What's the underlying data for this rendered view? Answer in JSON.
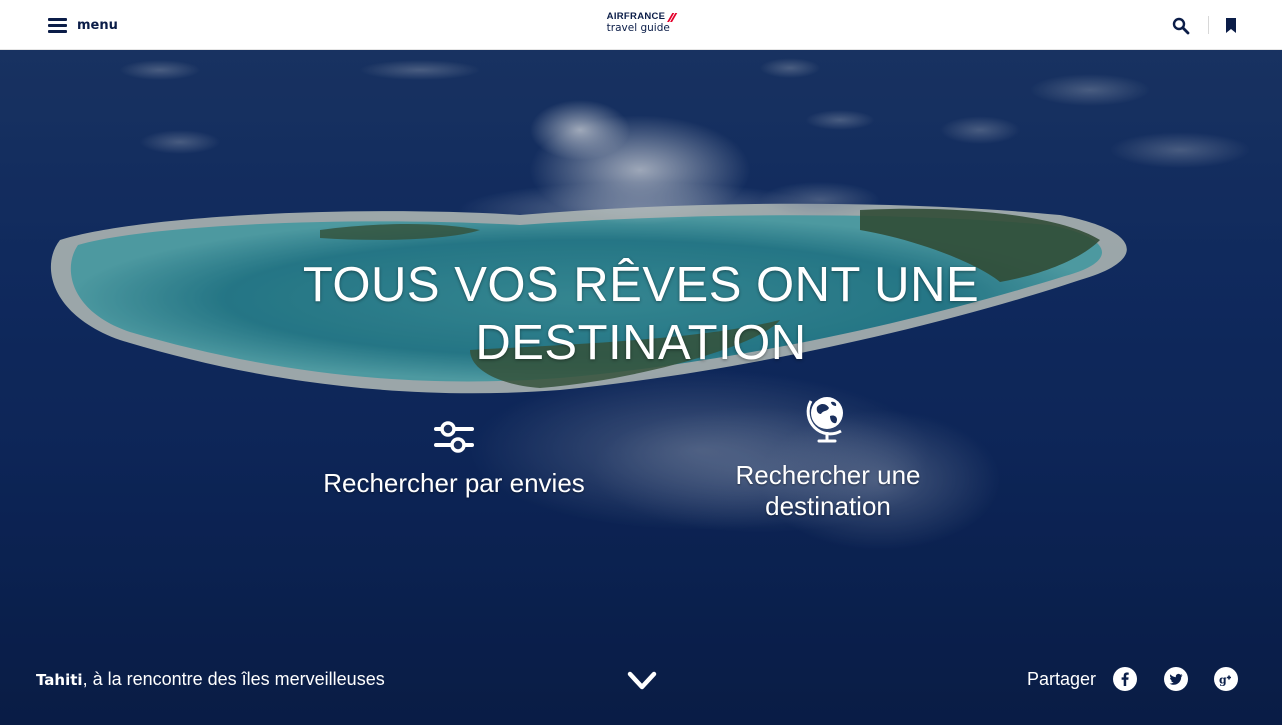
{
  "header": {
    "menu_label": "menu",
    "logo_brand": "AIRFRANCE",
    "logo_sub": "travel guide",
    "icons": [
      "hamburger-icon",
      "search-icon",
      "bookmark-icon"
    ]
  },
  "hero": {
    "headline_line1": "TOUS VOS RÊVES ONT UNE",
    "headline_line2": "DESTINATION",
    "cta_envies": "Rechercher par envies",
    "cta_destination_line1": "Rechercher une",
    "cta_destination_line2": "destination",
    "caption_place": "Tahiti",
    "caption_text": ", à la rencontre des îles merveilleuses",
    "share_label": "Partager",
    "icons": [
      "sliders-icon",
      "globe-icon",
      "chevron-down-icon",
      "facebook-icon",
      "twitter-icon",
      "google-plus-icon"
    ]
  },
  "colors": {
    "brand_navy": "#0b1d48",
    "brand_red": "#e4002b",
    "hero_ocean": "#13306a",
    "text_white": "#ffffff"
  }
}
